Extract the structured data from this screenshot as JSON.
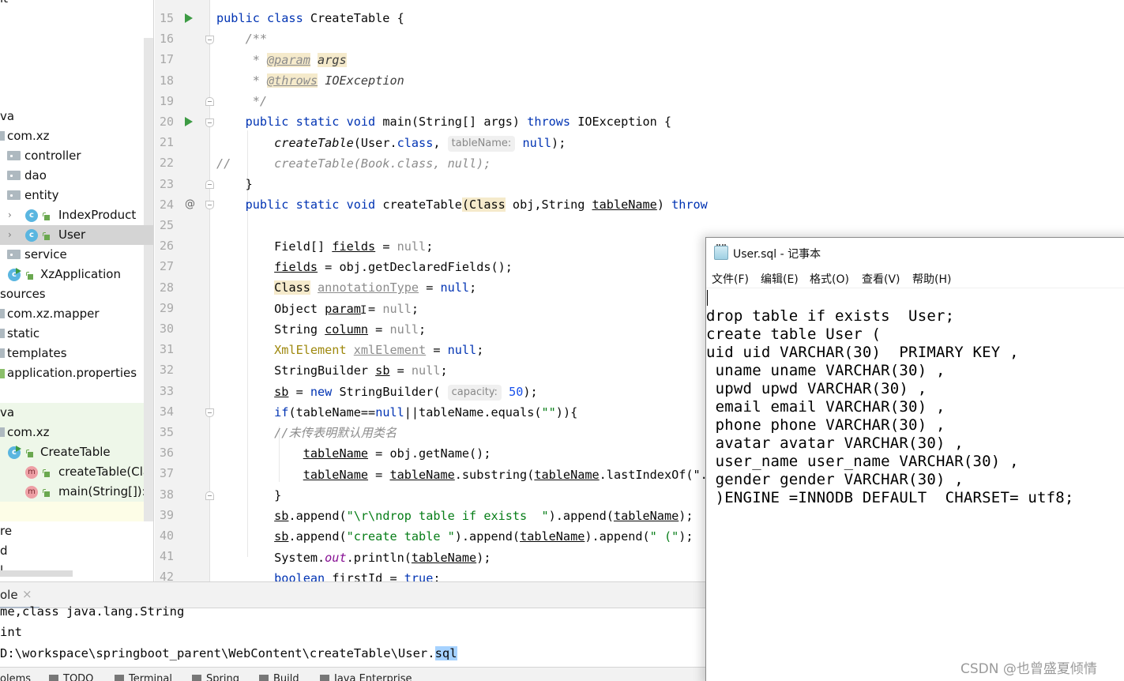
{
  "project_tree": {
    "rows": [
      {
        "label": "it",
        "indent": "cut"
      },
      {
        "label": "va"
      },
      {
        "label": "com.xz"
      },
      {
        "label": "controller"
      },
      {
        "label": "dao"
      },
      {
        "label": "entity"
      },
      {
        "label": "IndexProduct",
        "icon": "C"
      },
      {
        "label": "User",
        "icon": "C",
        "selected": true
      },
      {
        "label": "service"
      },
      {
        "label": "XzApplication",
        "icon": "C"
      },
      {
        "label": "sources"
      },
      {
        "label": "com.xz.mapper"
      },
      {
        "label": "static"
      },
      {
        "label": "templates"
      },
      {
        "label": "application.properties"
      },
      {
        "label": "va"
      },
      {
        "label": "com.xz"
      },
      {
        "label": "CreateTable",
        "icon": "C"
      },
      {
        "label": "createTable(Clas",
        "icon": "m"
      },
      {
        "label": "main(String[]):vo",
        "icon": "m"
      },
      {
        "label": "re"
      },
      {
        "label": "d"
      },
      {
        "label": "l"
      }
    ]
  },
  "editor": {
    "line_numbers": [
      "15",
      "16",
      "17",
      "18",
      "19",
      "20",
      "21",
      "22",
      "23",
      "24",
      "25",
      "26",
      "27",
      "28",
      "29",
      "30",
      "31",
      "32",
      "33",
      "34",
      "35",
      "36",
      "37",
      "38",
      "39",
      "40",
      "41",
      "42"
    ],
    "hints": {
      "tableName": "tableName:",
      "capacity": "capacity:"
    },
    "comment_cn": "//未传表明默认用类名"
  },
  "console": {
    "tab_label": "ole",
    "close_glyph": "×",
    "lines": [
      "me,class java.lang.String",
      "int",
      "D:\\workspace\\springboot_parent\\WebContent\\createTable\\User."
    ],
    "selected_suffix": "sql"
  },
  "bottom_bar": {
    "items": [
      "olems",
      "TODO",
      "Terminal",
      "Spring",
      "Build",
      "Java Enterprise"
    ]
  },
  "notepad": {
    "title": "User.sql - 记事本",
    "menu": [
      "文件(F)",
      "编辑(E)",
      "格式(O)",
      "查看(V)",
      "帮助(H)"
    ],
    "lines": [
      "drop table if exists  User;",
      "create table User (",
      "uid uid VARCHAR(30)  PRIMARY KEY ,",
      " uname uname VARCHAR(30) ,",
      " upwd upwd VARCHAR(30) ,",
      " email email VARCHAR(30) ,",
      " phone phone VARCHAR(30) ,",
      " avatar avatar VARCHAR(30) ,",
      " user_name user_name VARCHAR(30) ,",
      " gender gender VARCHAR(30) ,",
      " )ENGINE =INNODB DEFAULT  CHARSET= utf8;"
    ]
  },
  "watermark": "CSDN @也曾盛夏倾情"
}
